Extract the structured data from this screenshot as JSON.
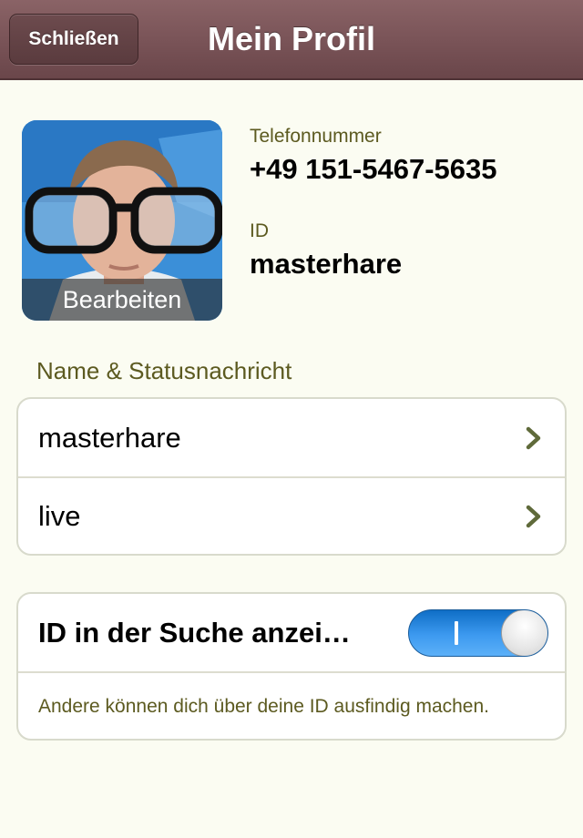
{
  "navbar": {
    "close_label": "Schließen",
    "title": "Mein Profil"
  },
  "profile": {
    "edit_label": "Bearbeiten",
    "phone_label": "Telefonnummer",
    "phone_value": "+49 151-5467-5635",
    "id_label": "ID",
    "id_value": "masterhare"
  },
  "name_section": {
    "header": "Name & Statusnachricht",
    "rows": [
      {
        "label": "masterhare"
      },
      {
        "label": "live"
      }
    ]
  },
  "id_search": {
    "label": "ID in der Suche anzei…",
    "toggle_on": true,
    "description": "Andere können dich über deine ID ausfindig machen."
  },
  "colors": {
    "navbar": "#7a5458",
    "background": "#fbfcf2",
    "label_olive": "#5c5a20",
    "toggle_blue": "#2f8ee6",
    "chevron": "#5f6a3a"
  }
}
